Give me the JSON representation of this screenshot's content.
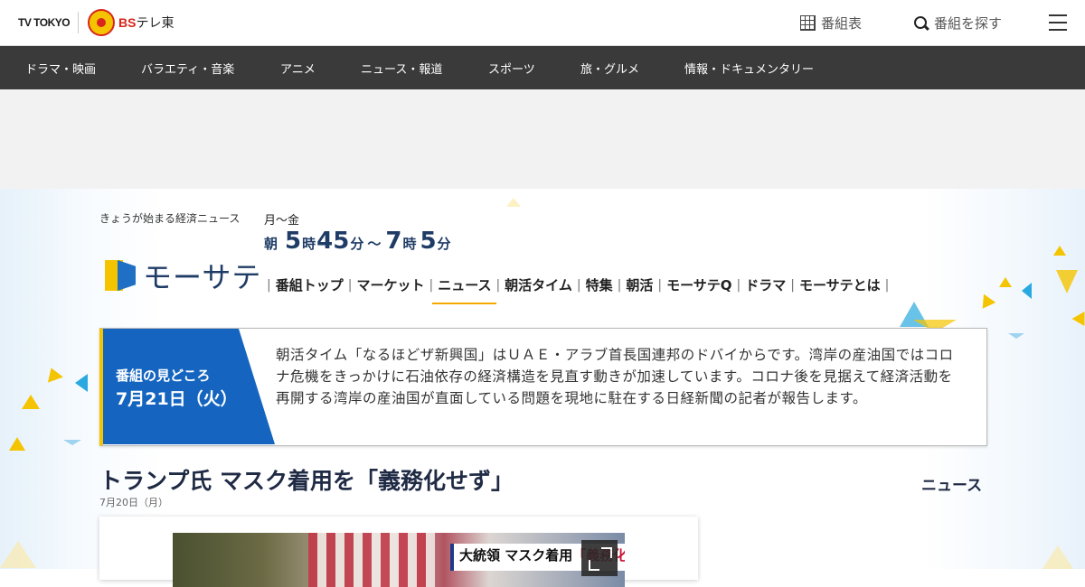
{
  "header": {
    "logo_tvtokyo": "TV TOKYO",
    "logo_bs_prefix": "BS",
    "logo_bs_text": "テレ東",
    "schedule_label": "番組表",
    "search_label": "番組を探す"
  },
  "genre_nav": [
    "ドラマ・映画",
    "バラエティ・音楽",
    "アニメ",
    "ニュース・報道",
    "スポーツ",
    "旅・グルメ",
    "情報・ドキュメンタリー"
  ],
  "program": {
    "tagline": "きょうが始まる経済ニュース",
    "name": "モーサテ",
    "air_days": "月～金",
    "air_time": {
      "prefix": "朝",
      "start_hour": "5",
      "hour_unit": "時",
      "start_min": "45",
      "min_unit": "分",
      "separator": "～",
      "end_hour": "7",
      "end_min": "5"
    },
    "nav": [
      "番組トップ",
      "マーケット",
      "ニュース",
      "朝活タイム",
      "特集",
      "朝活",
      "モーサテQ",
      "ドラマ",
      "モーサテとは"
    ],
    "nav_active": "ニュース"
  },
  "highlight": {
    "label": "番組の見どころ",
    "date": "7月21日（火）",
    "text": "朝活タイム「なるほどザ新興国」はＵＡＥ・アラブ首長国連邦のドバイからです。湾岸の産油国ではコロナ危機をきっかけに石油依存の経済構造を見直す動きが加速しています。コロナ後を見据えて経済活動を再開する湾岸の産油国が直面している問題を現地に駐在する日経新聞の記者が報告します。"
  },
  "article": {
    "title": "トランプ氏 マスク着用を「義務化せず」",
    "category": "ニュース",
    "date": "7月20日（月）",
    "caption_prefix": "大統領 マスク着用",
    "caption_highlight": "「義務化せ"
  },
  "colors": {
    "nav_bg": "#3a3a3a",
    "brand_blue": "#1565c0",
    "brand_yellow": "#f5c400",
    "active_underline": "#f5a800"
  }
}
